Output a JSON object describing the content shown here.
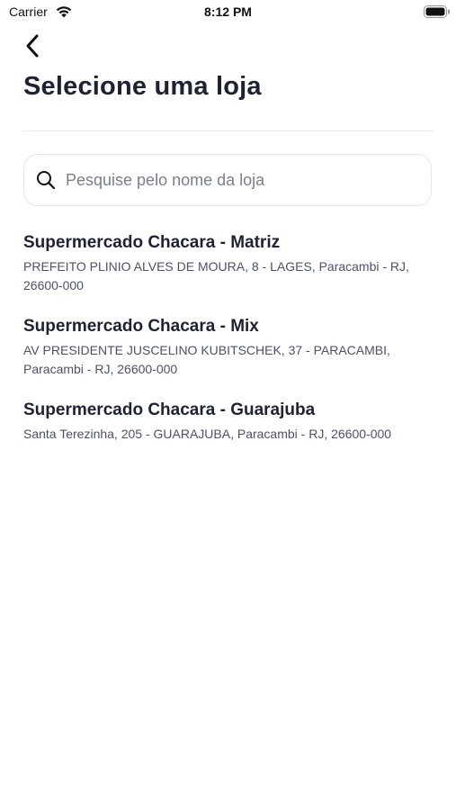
{
  "status_bar": {
    "carrier": "Carrier",
    "time": "8:12 PM"
  },
  "header": {
    "back_icon": "chevron-left-icon",
    "title": "Selecione uma loja"
  },
  "search": {
    "icon": "search-icon",
    "placeholder": "Pesquise pelo nome da loja",
    "value": ""
  },
  "stores": [
    {
      "name": "Supermercado Chacara - Matriz",
      "address": "PREFEITO PLINIO ALVES DE MOURA, 8 - LAGES, Paracambi - RJ, 26600-000"
    },
    {
      "name": "Supermercado Chacara - Mix",
      "address": "AV PRESIDENTE JUSCELINO KUBITSCHEK, 37 - PARACAMBI, Paracambi - RJ, 26600-000"
    },
    {
      "name": "Supermercado Chacara - Guarajuba",
      "address": "Santa Terezinha, 205 - GUARAJUBA, Paracambi - RJ, 26600-000"
    }
  ],
  "colors": {
    "text_primary": "#1e2233",
    "text_secondary": "#4c5168",
    "divider": "#e6e9f5",
    "border": "#e3e6ee"
  }
}
